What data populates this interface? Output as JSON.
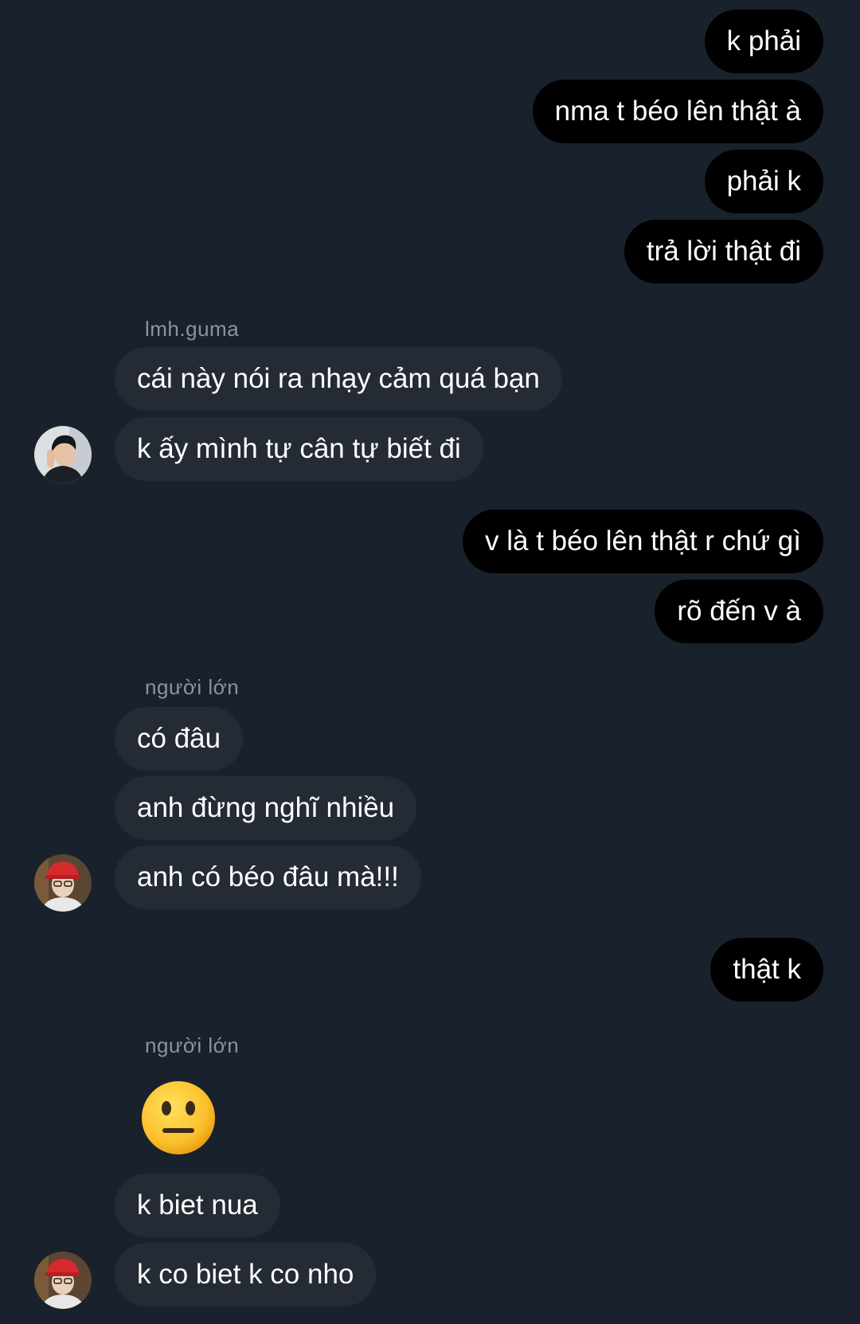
{
  "messages": {
    "m1": "k phải",
    "m2": "nma t béo lên thật à",
    "m3": "phải k",
    "m4": "trả lời thật đi",
    "sender1": "lmh.guma",
    "m5": "cái này nói ra nhạy cảm quá bạn",
    "m6": "k ấy mình tự cân tự biết đi",
    "m7": "v là t béo lên thật r chứ gì",
    "m8": "rõ đến v à",
    "sender2": "người lớn",
    "m9": "có đâu",
    "m10": "anh đừng nghĩ nhiều",
    "m11": "anh có béo đâu mà!!!",
    "m12": "thật k",
    "sender3": "người lớn",
    "m13": "k biet nua",
    "m14": "k co biet k co nho"
  },
  "icons": {
    "reaction": "neutral-face-emoji",
    "avatar1": "user-avatar",
    "avatar2": "user-avatar"
  },
  "colors": {
    "background": "#19212c",
    "outgoing_bubble": "#000000",
    "incoming_bubble": "#252b35",
    "sender_name": "#8e939b"
  }
}
